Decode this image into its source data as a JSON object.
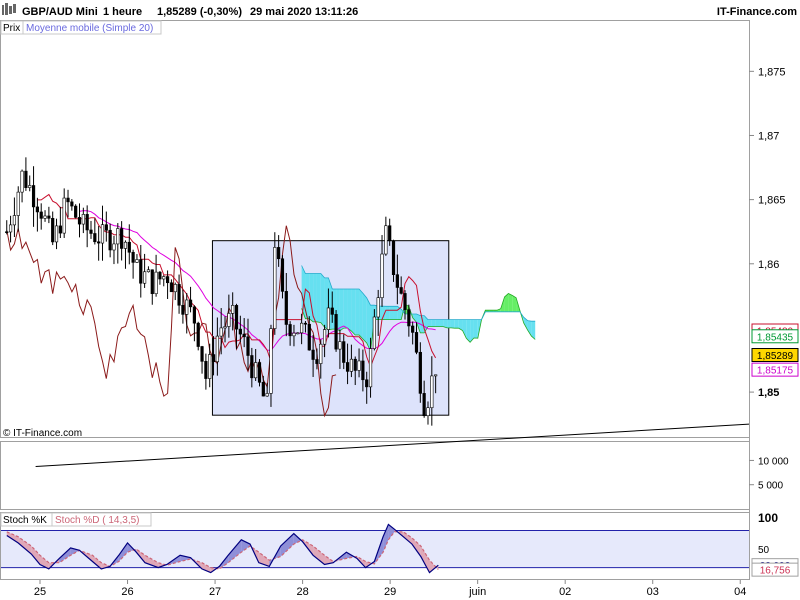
{
  "header": {
    "instrument": "GBP/AUD Mini",
    "timeframe": "1 heure",
    "price": "1,85289 (-0,30%)",
    "datetime": "29 mai 2020 13:11:26",
    "brand": "IT-Finance.com"
  },
  "legend": {
    "price_label": "Prix",
    "ma_label": "Moyenne mobile (Simple 20)"
  },
  "watermark": "© IT-Finance.com",
  "colors": {
    "candle": "#000000",
    "ma": "#e000e0",
    "tenkan": "#c8102e",
    "chikou": "#8b1a1a",
    "cloud_bull": "#66ee66",
    "cloud_bear": "#66e0f0",
    "box_fill": "#dde3fb",
    "stoch_k": "#000080",
    "stoch_d": "#cc6677",
    "price_tag": "#ffd700"
  },
  "chart_data": [
    {
      "type": "candlestick",
      "title": "GBP/AUD Mini",
      "y_ticks": [
        "1,875",
        "1,87",
        "1,865",
        "1,86",
        "1,85"
      ],
      "y_tick_values": [
        1.875,
        1.87,
        1.865,
        1.86,
        1.85
      ],
      "ylim": [
        1.8465,
        1.879
      ],
      "x_ticks": [
        "25",
        "26",
        "27",
        "28",
        "29",
        "juin",
        "02",
        "03",
        "04"
      ],
      "x_tick_days": [
        25,
        26,
        27,
        28,
        29,
        30,
        31,
        32,
        33
      ],
      "xlim_days": [
        24.6,
        33.1
      ],
      "indicators": [
        "Moyenne mobile (Simple 20)",
        "Ichimoku"
      ],
      "price_tags": [
        {
          "label": "1,85480",
          "value": 1.8548,
          "color": "#c8102e",
          "bg": "#ffffff"
        },
        {
          "label": "1,85435",
          "value": 1.85435,
          "color": "#009933",
          "bg": "#ffffff"
        },
        {
          "label": "1,85289",
          "value": 1.85289,
          "color": "#000000",
          "bg": "#ffd700"
        },
        {
          "label": "1,85175",
          "value": 1.85175,
          "color": "#cc00cc",
          "bg": "#ffffff"
        }
      ],
      "consolidation_box": {
        "day_start": 26.97,
        "day_end": 29.67,
        "price_top": 1.8618,
        "price_bottom": 1.8482
      },
      "trendline": {
        "day_start": 24.95,
        "price_start": 1.8442,
        "day_end": 33.1,
        "price_end": 1.8475
      },
      "closes": [
        {
          "day": 24.62,
          "close": 1.8625
        },
        {
          "day": 24.8,
          "close": 1.867
        },
        {
          "day": 25.0,
          "close": 1.8645
        },
        {
          "day": 25.15,
          "close": 1.8615
        },
        {
          "day": 25.3,
          "close": 1.8648
        },
        {
          "day": 25.5,
          "close": 1.8628
        },
        {
          "day": 25.7,
          "close": 1.862
        },
        {
          "day": 25.95,
          "close": 1.8623
        },
        {
          "day": 26.1,
          "close": 1.8595
        },
        {
          "day": 26.3,
          "close": 1.8585
        },
        {
          "day": 26.45,
          "close": 1.8592
        },
        {
          "day": 26.6,
          "close": 1.8575
        },
        {
          "day": 26.78,
          "close": 1.8555
        },
        {
          "day": 26.9,
          "close": 1.851
        },
        {
          "day": 27.05,
          "close": 1.855
        },
        {
          "day": 27.2,
          "close": 1.8557
        },
        {
          "day": 27.35,
          "close": 1.8535
        },
        {
          "day": 27.5,
          "close": 1.8505
        },
        {
          "day": 27.6,
          "close": 1.8488
        },
        {
          "day": 27.68,
          "close": 1.862
        },
        {
          "day": 27.8,
          "close": 1.8555
        },
        {
          "day": 28.0,
          "close": 1.8548
        },
        {
          "day": 28.15,
          "close": 1.853
        },
        {
          "day": 28.3,
          "close": 1.8558
        },
        {
          "day": 28.45,
          "close": 1.853
        },
        {
          "day": 28.6,
          "close": 1.8515
        },
        {
          "day": 28.75,
          "close": 1.8512
        },
        {
          "day": 28.85,
          "close": 1.8575
        },
        {
          "day": 28.95,
          "close": 1.8622
        },
        {
          "day": 29.1,
          "close": 1.858
        },
        {
          "day": 29.25,
          "close": 1.8548
        },
        {
          "day": 29.4,
          "close": 1.8488
        },
        {
          "day": 29.55,
          "close": 1.8529
        }
      ]
    },
    {
      "type": "bar",
      "title": "Volume",
      "y_ticks": [
        "10 000",
        "5 000"
      ],
      "y_tick_values": [
        10000,
        5000
      ],
      "ylim": [
        0,
        14000
      ],
      "values": []
    },
    {
      "type": "line",
      "title": "Stochastique",
      "series_labels": [
        "Stoch %K",
        "Stoch %D ( 14,3,5)"
      ],
      "y_ticks": [
        "100",
        "50"
      ],
      "y_tick_values": [
        100,
        50
      ],
      "ylim": [
        0,
        110
      ],
      "levels": [
        80,
        20
      ],
      "current_labels": [
        {
          "label": "23,992",
          "value": 23.992,
          "color": "#000080"
        },
        {
          "label": "16,756",
          "value": 16.756,
          "color": "#cc3355"
        }
      ],
      "series": [
        {
          "name": "Stoch %K",
          "points": [
            [
              24.62,
              72
            ],
            [
              24.75,
              60
            ],
            [
              24.9,
              42
            ],
            [
              25.0,
              25
            ],
            [
              25.1,
              18
            ],
            [
              25.22,
              35
            ],
            [
              25.35,
              52
            ],
            [
              25.45,
              48
            ],
            [
              25.6,
              30
            ],
            [
              25.7,
              18
            ],
            [
              25.8,
              22
            ],
            [
              25.9,
              40
            ],
            [
              26.0,
              60
            ],
            [
              26.1,
              45
            ],
            [
              26.2,
              28
            ],
            [
              26.35,
              20
            ],
            [
              26.45,
              25
            ],
            [
              26.6,
              40
            ],
            [
              26.72,
              36
            ],
            [
              26.85,
              18
            ],
            [
              26.95,
              12
            ],
            [
              27.05,
              22
            ],
            [
              27.15,
              40
            ],
            [
              27.3,
              65
            ],
            [
              27.4,
              58
            ],
            [
              27.5,
              28
            ],
            [
              27.62,
              22
            ],
            [
              27.75,
              55
            ],
            [
              27.9,
              75
            ],
            [
              28.0,
              62
            ],
            [
              28.12,
              40
            ],
            [
              28.25,
              25
            ],
            [
              28.35,
              28
            ],
            [
              28.5,
              45
            ],
            [
              28.62,
              35
            ],
            [
              28.72,
              20
            ],
            [
              28.82,
              30
            ],
            [
              28.92,
              70
            ],
            [
              28.98,
              90
            ],
            [
              29.05,
              82
            ],
            [
              29.15,
              70
            ],
            [
              29.25,
              58
            ],
            [
              29.35,
              38
            ],
            [
              29.45,
              12
            ],
            [
              29.55,
              24
            ]
          ]
        },
        {
          "name": "Stoch %D ( 14,3,5)",
          "points": [
            [
              24.62,
              78
            ],
            [
              24.75,
              70
            ],
            [
              24.9,
              55
            ],
            [
              25.0,
              40
            ],
            [
              25.1,
              28
            ],
            [
              25.22,
              28
            ],
            [
              25.35,
              40
            ],
            [
              25.45,
              48
            ],
            [
              25.6,
              40
            ],
            [
              25.7,
              28
            ],
            [
              25.8,
              22
            ],
            [
              25.9,
              30
            ],
            [
              26.0,
              45
            ],
            [
              26.1,
              50
            ],
            [
              26.2,
              40
            ],
            [
              26.35,
              28
            ],
            [
              26.45,
              24
            ],
            [
              26.6,
              30
            ],
            [
              26.72,
              34
            ],
            [
              26.85,
              28
            ],
            [
              26.95,
              20
            ],
            [
              27.05,
              18
            ],
            [
              27.15,
              28
            ],
            [
              27.3,
              45
            ],
            [
              27.4,
              55
            ],
            [
              27.5,
              45
            ],
            [
              27.62,
              32
            ],
            [
              27.75,
              38
            ],
            [
              27.9,
              58
            ],
            [
              28.0,
              65
            ],
            [
              28.12,
              55
            ],
            [
              28.25,
              40
            ],
            [
              28.35,
              30
            ],
            [
              28.5,
              35
            ],
            [
              28.62,
              38
            ],
            [
              28.72,
              30
            ],
            [
              28.82,
              26
            ],
            [
              28.92,
              45
            ],
            [
              28.98,
              65
            ],
            [
              29.05,
              78
            ],
            [
              29.15,
              78
            ],
            [
              29.25,
              68
            ],
            [
              29.35,
              55
            ],
            [
              29.45,
              32
            ],
            [
              29.55,
              17
            ]
          ]
        }
      ]
    }
  ]
}
